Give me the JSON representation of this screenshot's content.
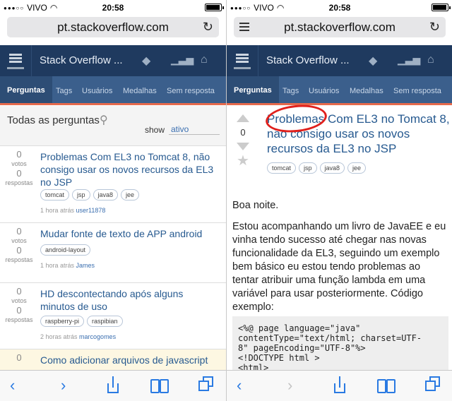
{
  "status": {
    "carrier": "VIVO",
    "time": "20:58"
  },
  "browser": {
    "url": "pt.stackoverflow.com"
  },
  "site": {
    "title": "Stack Overflow ..."
  },
  "nav": {
    "tabs": [
      "Perguntas",
      "Tags",
      "Usuários",
      "Medalhas",
      "Sem resposta"
    ]
  },
  "filter": {
    "title": "Todas as perguntas",
    "show_label": "show",
    "show_value": "ativo"
  },
  "questions": [
    {
      "votes": "0",
      "votes_label": "votos",
      "answers": "0",
      "answers_label": "respostas",
      "title": "Problemas Com EL3 no Tomcat 8, não consigo usar os novos recursos da EL3 no JSP",
      "tags": [
        "tomcat",
        "jsp",
        "java8",
        "jee"
      ],
      "time": "1 hora atrás",
      "user": "user11878"
    },
    {
      "votes": "0",
      "votes_label": "votos",
      "answers": "0",
      "answers_label": "respostas",
      "title": "Mudar fonte de texto de APP android",
      "tags": [
        "android-layout"
      ],
      "time": "1 hora atrás",
      "user": "James"
    },
    {
      "votes": "0",
      "votes_label": "votos",
      "answers": "0",
      "answers_label": "respostas",
      "title": "HD descontectando após alguns minutos de uso",
      "tags": [
        "raspberry-pi",
        "raspibian"
      ],
      "time": "2 horas atrás",
      "user": "marcogomes"
    },
    {
      "votes": "0",
      "title": "Como adicionar arquivos de javascript"
    }
  ],
  "detail": {
    "score": "0",
    "title": "Problemas Com EL3 no Tomcat 8, não consigo usar os novos recursos da EL3 no JSP",
    "tags": [
      "tomcat",
      "jsp",
      "java8",
      "jee"
    ],
    "paragraphs": [
      "Boa noite.",
      "Estou acompanhando um livro de JavaEE e eu vinha tendo sucesso até chegar nas novas funcionalidade da EL3, seguindo um exemplo bem básico eu estou tendo problemas ao tentar atribuir uma função lambda em uma variável para usar posteriormente. Código exemplo:"
    ],
    "code": "<%@ page language=\"java\"\ncontentType=\"text/html; charset=UTF-\n8\" pageEncoding=\"UTF-8\"%>\n<!DOCTYPE html >\n<html>"
  }
}
